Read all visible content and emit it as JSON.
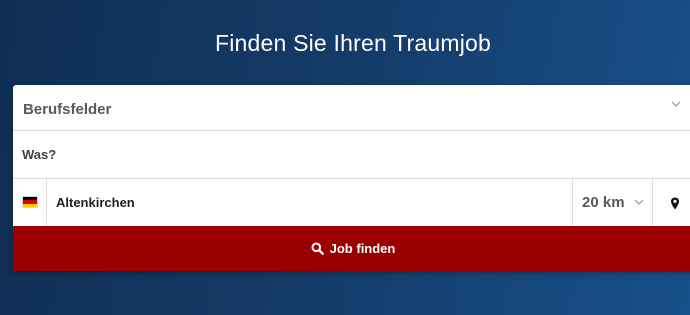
{
  "hero": {
    "title": "Finden Sie Ihren Traumjob"
  },
  "search": {
    "category_label": "Berufsfelder",
    "category_icon": "chevron-down-icon",
    "what_placeholder": "Was?",
    "what_value": "",
    "country_flag": "germany-flag-icon",
    "flag_colors": [
      "#000000",
      "#dd0000",
      "#ffce00"
    ],
    "location_value": "Altenkirchen",
    "radius_value": "20 km",
    "radius_icon": "chevron-down-icon",
    "locate_icon": "map-pin-icon",
    "submit_label": "Job finden",
    "submit_icon": "search-icon",
    "submit_color": "#9a0000"
  }
}
